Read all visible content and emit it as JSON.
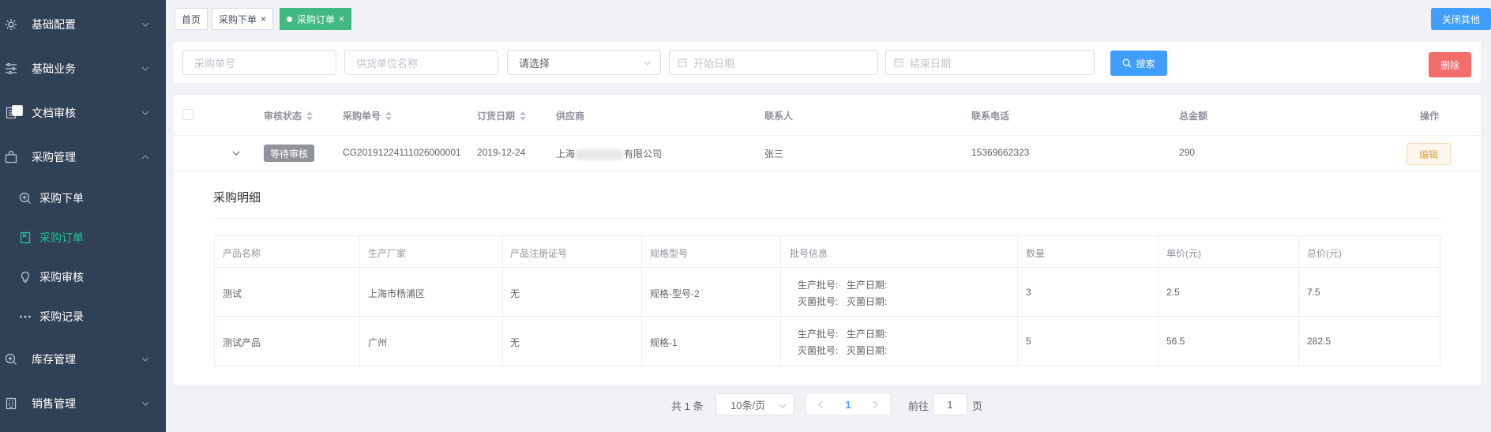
{
  "sidebar": {
    "menus": [
      {
        "label": "基础配置",
        "icon": "gear-icon"
      },
      {
        "label": "基础业务",
        "icon": "sliders-icon"
      },
      {
        "label": "文档审核",
        "icon": "document-icon"
      },
      {
        "label": "采购管理",
        "icon": "bag-icon"
      },
      {
        "label": "库存管理",
        "icon": "zoom-in-icon"
      },
      {
        "label": "销售管理",
        "icon": "building-icon"
      }
    ],
    "sub_items": [
      {
        "label": "采购下单",
        "icon": "circle-plus-icon"
      },
      {
        "label": "采购订单",
        "icon": "notebook-icon"
      },
      {
        "label": "采购审核",
        "icon": "bulb-icon"
      },
      {
        "label": "采购记录",
        "icon": "more-dots-icon"
      }
    ]
  },
  "tags": {
    "items": [
      "首页",
      "采购下单",
      "采购订单"
    ],
    "close_symbol": "×",
    "close_others": "关闭其他"
  },
  "filter": {
    "order_no_placeholder": "采购单号",
    "supplier_placeholder": "供货单位名称",
    "select_value": "请选择",
    "start_date_placeholder": "开始日期",
    "end_date_placeholder": "结束日期",
    "search_label": "搜索",
    "delete_label": "删除"
  },
  "table": {
    "headers": [
      "审核状态",
      "采购单号",
      "订货日期",
      "供应商",
      "联系人",
      "联系电话",
      "总金额",
      "操作"
    ],
    "row": {
      "status": "等待审核",
      "order_no": "CG20191224111026000001",
      "date": "2019-12-24",
      "supplier_prefix": "上海",
      "supplier_suffix": "有限公司",
      "contact": "张三",
      "phone": "15369662323",
      "total": "290",
      "edit_label": "编辑"
    }
  },
  "detail": {
    "title": "采购明细",
    "headers": [
      "产品名称",
      "生产厂家",
      "产品注册证号",
      "规格型号",
      "批号信息",
      "数量",
      "单价(元)",
      "总价(元)"
    ],
    "batch_labels": [
      "生产批号:",
      "生产日期:",
      "灭菌批号:",
      "灭菌日期:"
    ],
    "rows": [
      {
        "name": "测试",
        "maker": "上海市杨浦区",
        "reg": "无",
        "spec": "规格-型号-2",
        "qty": "3",
        "price": "2.5",
        "total": "7.5"
      },
      {
        "name": "测试产品",
        "maker": "广州",
        "reg": "无",
        "spec": "规格-1",
        "qty": "5",
        "price": "56.5",
        "total": "282.5"
      }
    ]
  },
  "pagination": {
    "total_text": "共 1 条",
    "page_size": "10条/页",
    "current_page": "1",
    "goto_label": "前往",
    "goto_value": "1",
    "page_suffix": "页"
  },
  "colors": {
    "sidebar_bg": "#304156",
    "active_green": "#42b983",
    "primary": "#409eff",
    "danger": "#f56c6c",
    "warning": "#e6a23c"
  }
}
